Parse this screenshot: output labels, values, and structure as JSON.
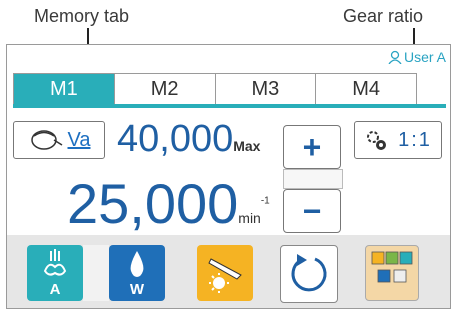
{
  "callouts": {
    "memory_tab": "Memory tab",
    "gear_ratio": "Gear ratio"
  },
  "header": {
    "user_label": "User A"
  },
  "tabs": [
    {
      "label": "M1",
      "active": true
    },
    {
      "label": "M2",
      "active": false
    },
    {
      "label": "M3",
      "active": false
    },
    {
      "label": "M4",
      "active": false
    }
  ],
  "mode": {
    "label": "Va"
  },
  "speed": {
    "max_value": "40,000",
    "max_suffix": "Max",
    "current_value": "25,000",
    "unit": "min",
    "unit_exp": "-1"
  },
  "controls": {
    "plus": "+",
    "minus": "−"
  },
  "gear": {
    "ratio": "1:1"
  },
  "bottom_buttons": {
    "air_letter": "A",
    "water_letter": "W"
  },
  "colors": {
    "accent": "#29aeb9",
    "number_blue": "#1f5fa3",
    "water_blue": "#1f6fb8",
    "light_orange": "#f5b323"
  },
  "icons": [
    "user-icon",
    "handpiece-icon",
    "gear-icon",
    "air-icon",
    "water-drop-icon",
    "light-icon",
    "rotation-icon",
    "settings-grid-icon"
  ]
}
